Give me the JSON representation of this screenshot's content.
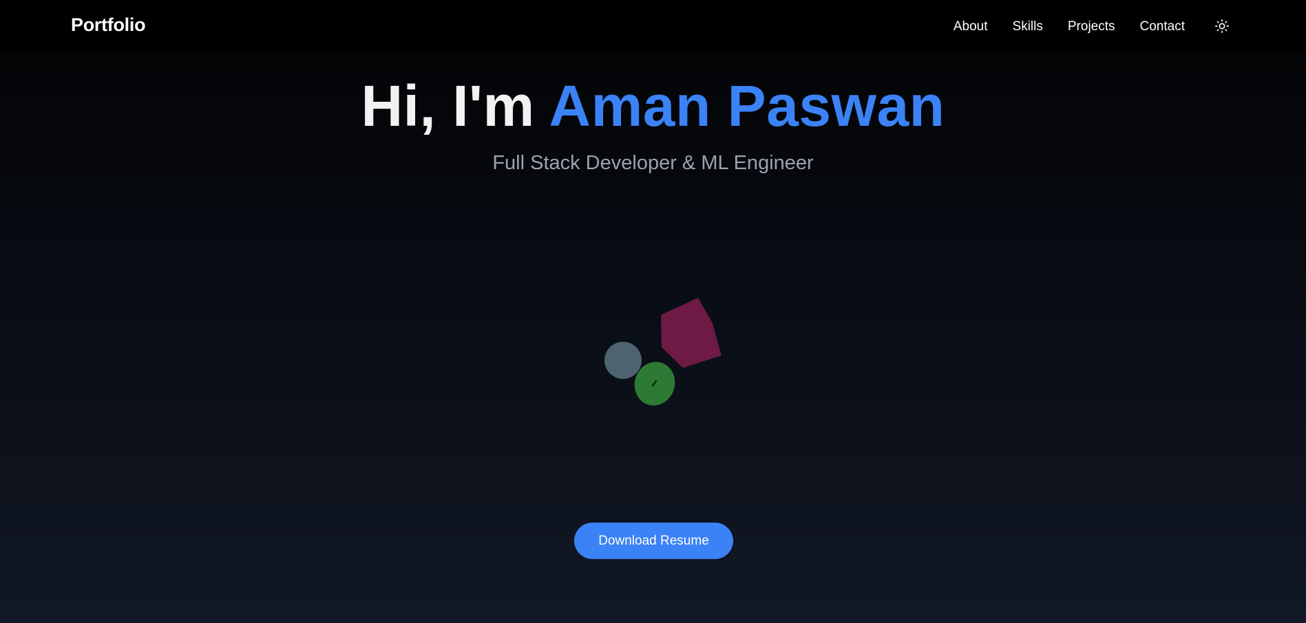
{
  "navbar": {
    "brand": "Portfolio",
    "links": [
      "About",
      "Skills",
      "Projects",
      "Contact"
    ],
    "theme_toggle_icon": "sun-icon"
  },
  "hero": {
    "greeting": "Hi, I'm ",
    "name": "Aman Paswan",
    "subtitle": "Full Stack Developer & ML Engineer"
  },
  "scene": {
    "shapes": [
      {
        "kind": "sphere",
        "color": "#4d6370"
      },
      {
        "kind": "pentagon-prism",
        "color": "#6d1a45"
      },
      {
        "kind": "torus",
        "color": "#2d7a34"
      }
    ]
  },
  "cta": {
    "label": "Download Resume"
  },
  "colors": {
    "accent": "#3b82f6",
    "subtitle": "#9ca3af",
    "navbar_bg": "#000000"
  }
}
